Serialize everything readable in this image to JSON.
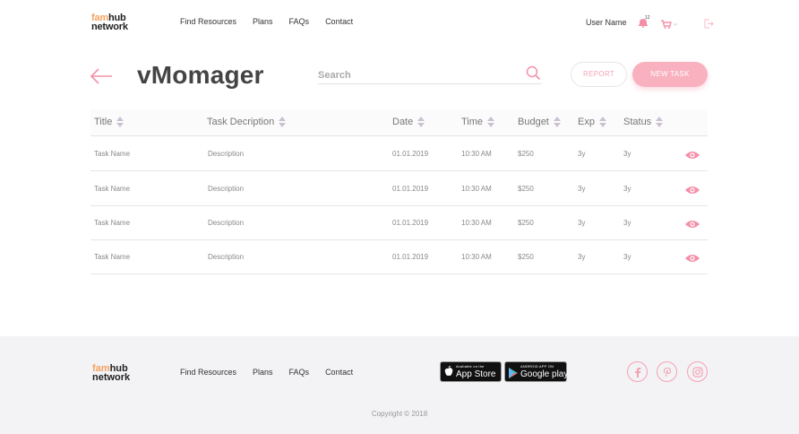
{
  "header": {
    "logo_line1_a": "fam",
    "logo_line1_b": "hub",
    "logo_line2": "network",
    "nav": [
      "Find Resources",
      "Plans",
      "FAQs",
      "Contact"
    ],
    "user_name": "User Name",
    "notification_count": "12"
  },
  "page": {
    "title": "vMomager",
    "search_placeholder": "Search",
    "report_label": "REPORT",
    "new_task_label": "NEW TASK"
  },
  "table": {
    "columns": [
      "Title",
      "Task Decription",
      "Date",
      "Time",
      "Budget",
      "Exp",
      "Status"
    ],
    "rows": [
      {
        "title": "Task Name",
        "description": "Description",
        "date": "01.01.2019",
        "time": "10:30 AM",
        "budget": "$250",
        "exp": "3y",
        "status": "3y"
      },
      {
        "title": "Task Name",
        "description": "Description",
        "date": "01.01.2019",
        "time": "10:30 AM",
        "budget": "$250",
        "exp": "3y",
        "status": "3y"
      },
      {
        "title": "Task Name",
        "description": "Description",
        "date": "01.01.2019",
        "time": "10:30 AM",
        "budget": "$250",
        "exp": "3y",
        "status": "3y"
      },
      {
        "title": "Task Name",
        "description": "Description",
        "date": "01.01.2019",
        "time": "10:30 AM",
        "budget": "$250",
        "exp": "3y",
        "status": "3y"
      }
    ]
  },
  "footer": {
    "logo_line1_a": "fam",
    "logo_line1_b": "hub",
    "logo_line2": "network",
    "nav": [
      "Find Resources",
      "Plans",
      "FAQs",
      "Contact"
    ],
    "app_store_small": "Available on the",
    "app_store_big": "App Store",
    "google_small": "ANDROID APP ON",
    "google_big": "Google play",
    "copyright": "Copyright © 2018"
  },
  "colors": {
    "accent_pink": "#f9b0bf",
    "accent_pink_dark": "#f48fa8",
    "text_dark": "#444444"
  },
  "icons": [
    "notification-bell-icon",
    "cart-icon",
    "logout-icon",
    "back-arrow-icon",
    "search-icon",
    "eye-icon",
    "facebook-icon",
    "pinterest-icon",
    "instagram-icon"
  ]
}
